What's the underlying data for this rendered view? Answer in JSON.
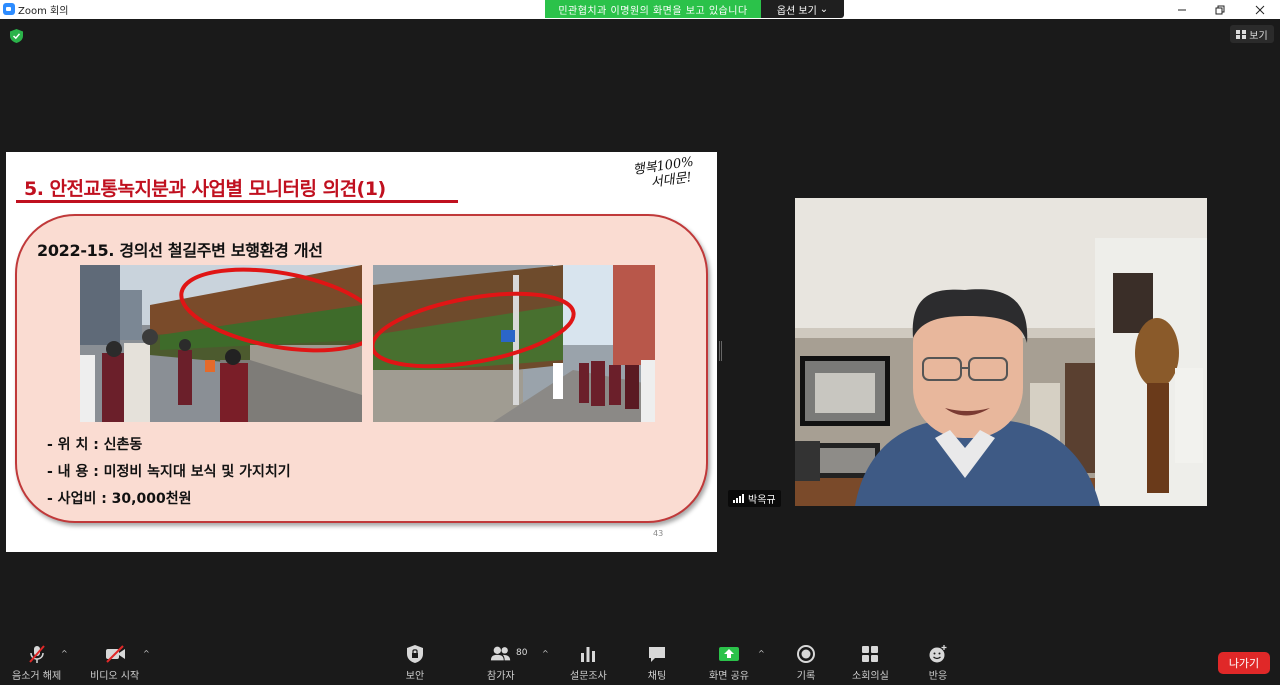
{
  "window": {
    "title": "Zoom 회의",
    "share_banner": "민관협치과 이명원의 화면을 보고 있습니다",
    "view_options": "옵션 보기",
    "view_button": "보기"
  },
  "slide": {
    "title": "5. 안전교통녹지분과 사업별 모니터링 의견(1)",
    "slogan_line1": "행복100%",
    "slogan_line2": "서대문!",
    "heading": "2022-15. 경의선 철길주변 보행환경 개선",
    "details": [
      "- 위   치 : 신촌동",
      "- 내   용 : 미정비 녹지대 보식 및 가지치기",
      "- 사업비 : 30,000천원"
    ],
    "page_number": "43"
  },
  "participant": {
    "name": "박옥규"
  },
  "toolbar": {
    "unmute": "음소거 해제",
    "start_video": "비디오 시작",
    "security": "보안",
    "participants": "참가자",
    "participant_count": "80",
    "polls": "설문조사",
    "chat": "채팅",
    "share_screen": "화면 공유",
    "record": "기록",
    "breakout": "소회의실",
    "reactions": "반응",
    "leave": "나가기"
  },
  "colors": {
    "banner_green": "#2bc24a",
    "slide_red": "#c0101f",
    "card_fill": "#fadcd2",
    "leave_red": "#e02828",
    "share_green": "#2bc24a"
  }
}
